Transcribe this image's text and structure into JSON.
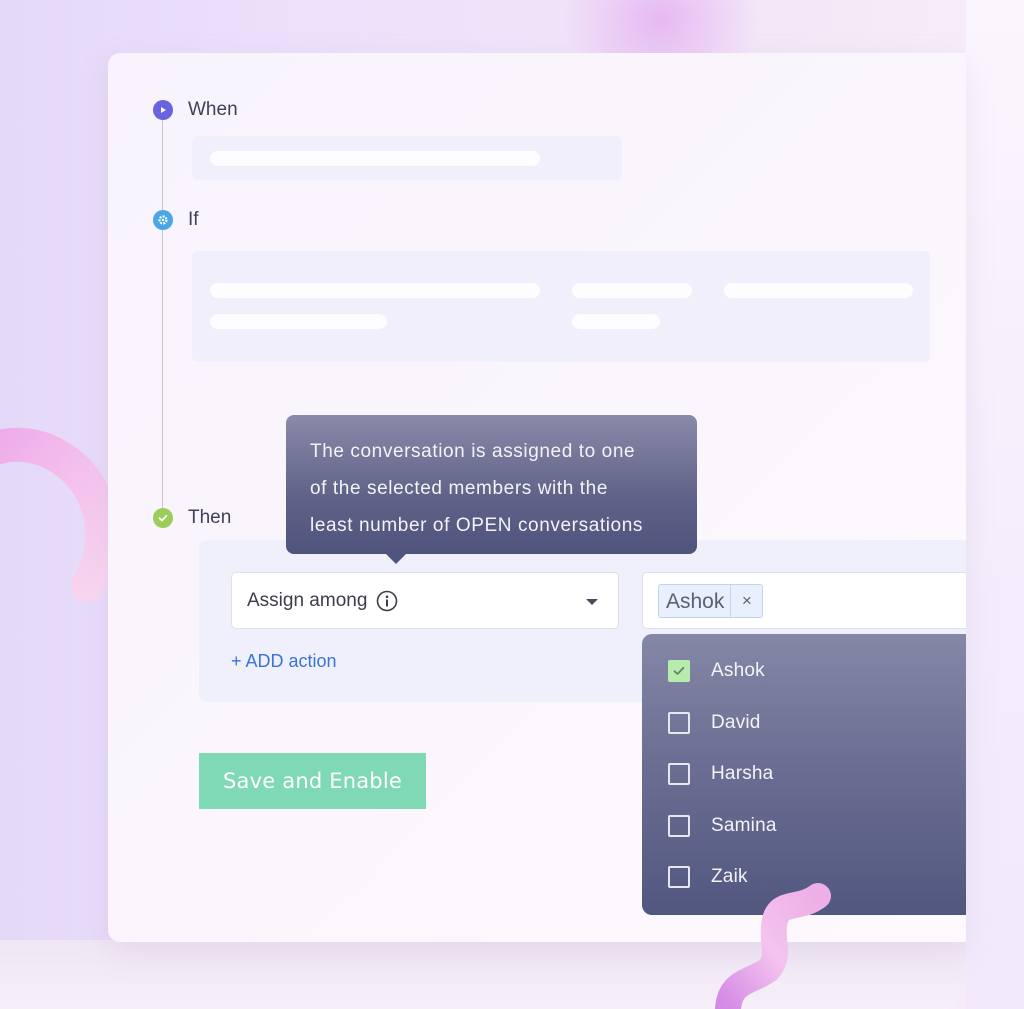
{
  "workflow": {
    "steps": [
      {
        "label": "When",
        "icon": "play-icon",
        "color": "#6a63e0"
      },
      {
        "label": "If",
        "icon": "gear-icon",
        "color": "#4ba6e6"
      },
      {
        "label": "Then",
        "icon": "check-circle-icon",
        "color": "#9acd5a"
      }
    ]
  },
  "action": {
    "select_value": "Assign among",
    "info_icon": "info-icon",
    "caret_icon": "caret-down-icon",
    "add_action_label": "+ ADD action"
  },
  "tooltip": {
    "lines": [
      "The conversation is assigned to one",
      "of the selected members with the",
      "least number of OPEN conversations"
    ]
  },
  "members": {
    "selected_chips": [
      {
        "label": "Ashok",
        "remove": "×"
      }
    ],
    "options": [
      {
        "label": "Ashok",
        "checked": true
      },
      {
        "label": "David",
        "checked": false
      },
      {
        "label": "Harsha",
        "checked": false
      },
      {
        "label": "Samina",
        "checked": false
      },
      {
        "label": "Zaik",
        "checked": false
      }
    ]
  },
  "footer": {
    "save_label": "Save and Enable"
  },
  "colors": {
    "save_button": "#7fd9b5",
    "link": "#3b74d4",
    "checkbox_checked": "#b6ecac",
    "tooltip_bg": "#5f6287"
  }
}
